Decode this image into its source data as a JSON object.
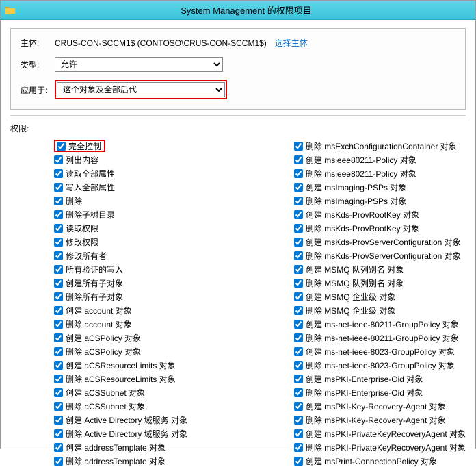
{
  "window": {
    "title": "System Management 的权限项目"
  },
  "header": {
    "principal_label": "主体:",
    "principal_value": "CRUS-CON-SCCM1$ (CONTOSO\\CRUS-CON-SCCM1$)",
    "select_principal_link": "选择主体",
    "type_label": "类型:",
    "type_value": "允许",
    "applies_label": "应用于:",
    "applies_value": "这个对象及全部后代"
  },
  "permissions": {
    "section_label": "权限:",
    "left": [
      "完全控制",
      "列出内容",
      "读取全部属性",
      "写入全部属性",
      "删除",
      "删除子树目录",
      "读取权限",
      "修改权限",
      "修改所有者",
      "所有验证的写入",
      "创建所有子对象",
      "删除所有子对象",
      "创建 account 对象",
      "删除 account 对象",
      "创建 aCSPolicy 对象",
      "删除 aCSPolicy 对象",
      "创建 aCSResourceLimits 对象",
      "删除 aCSResourceLimits 对象",
      "创建 aCSSubnet 对象",
      "删除 aCSSubnet 对象",
      "创建 Active Directory 域服务 对象",
      "删除 Active Directory 域服务 对象",
      "创建 addressTemplate 对象",
      "删除 addressTemplate 对象"
    ],
    "right": [
      "删除 msExchConfigurationContainer 对象",
      "创建 msieee80211-Policy 对象",
      "删除 msieee80211-Policy 对象",
      "创建 msImaging-PSPs 对象",
      "删除 msImaging-PSPs 对象",
      "创建 msKds-ProvRootKey 对象",
      "删除 msKds-ProvRootKey 对象",
      "创建 msKds-ProvServerConfiguration 对象",
      "删除 msKds-ProvServerConfiguration 对象",
      "创建 MSMQ 队列别名 对象",
      "删除 MSMQ 队列别名 对象",
      "创建 MSMQ 企业级 对象",
      "删除 MSMQ 企业级 对象",
      "创建 ms-net-ieee-80211-GroupPolicy 对象",
      "删除 ms-net-ieee-80211-GroupPolicy 对象",
      "创建 ms-net-ieee-8023-GroupPolicy 对象",
      "删除 ms-net-ieee-8023-GroupPolicy 对象",
      "创建 msPKI-Enterprise-Oid 对象",
      "删除 msPKI-Enterprise-Oid 对象",
      "创建 msPKI-Key-Recovery-Agent 对象",
      "删除 msPKI-Key-Recovery-Agent 对象",
      "创建 msPKI-PrivateKeyRecoveryAgent 对象",
      "删除 msPKI-PrivateKeyRecoveryAgent 对象",
      "创建 msPrint-ConnectionPolicy 对象"
    ]
  }
}
